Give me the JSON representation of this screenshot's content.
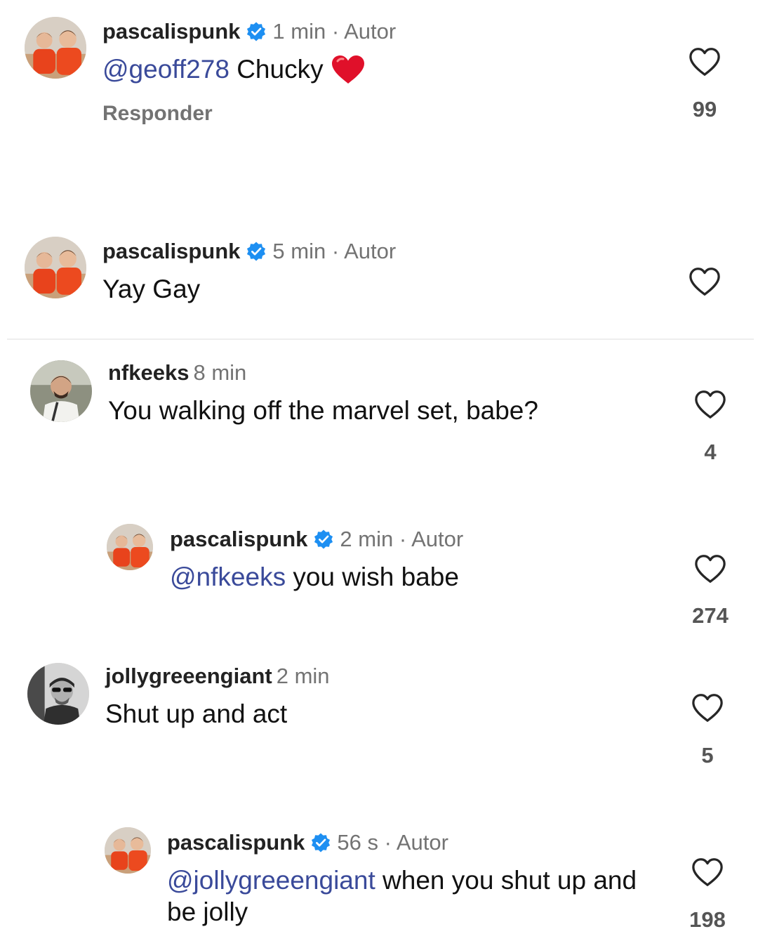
{
  "comments": [
    {
      "username": "pascalispunk",
      "verified": true,
      "time": "1 min",
      "author_tag": "Autor",
      "mention": "@geoff278",
      "text": " Chucky",
      "reply_label": "Responder",
      "likes": "99"
    },
    {
      "username": "pascalispunk",
      "verified": true,
      "time": "5 min",
      "author_tag": "Autor",
      "text": "Yay Gay"
    },
    {
      "username": "nfkeeks",
      "time": "8 min",
      "text": "You walking off the marvel set, babe?",
      "likes": "4"
    },
    {
      "username": "pascalispunk",
      "verified": true,
      "time": "2 min",
      "author_tag": "Autor",
      "mention": "@nfkeeks",
      "text": " you wish babe",
      "likes": "274"
    },
    {
      "username": "jollygreeengiant",
      "time": "2 min",
      "text": "Shut up and act",
      "likes": "5"
    },
    {
      "username": "pascalispunk",
      "verified": true,
      "time": "56 s",
      "author_tag": "Autor",
      "mention": "@jollygreeengiant",
      "text": " when you shut up and be jolly",
      "likes": "198"
    }
  ],
  "separator": " · ",
  "icons": {
    "verified": "verified-badge-icon",
    "like": "heart-outline-icon",
    "emoji": "red-heart-emoji"
  },
  "colors": {
    "verified_blue": "#1d8ff2",
    "mention": "#3a4a9a",
    "meta_gray": "#737373",
    "emoji_red": "#e0102a"
  }
}
